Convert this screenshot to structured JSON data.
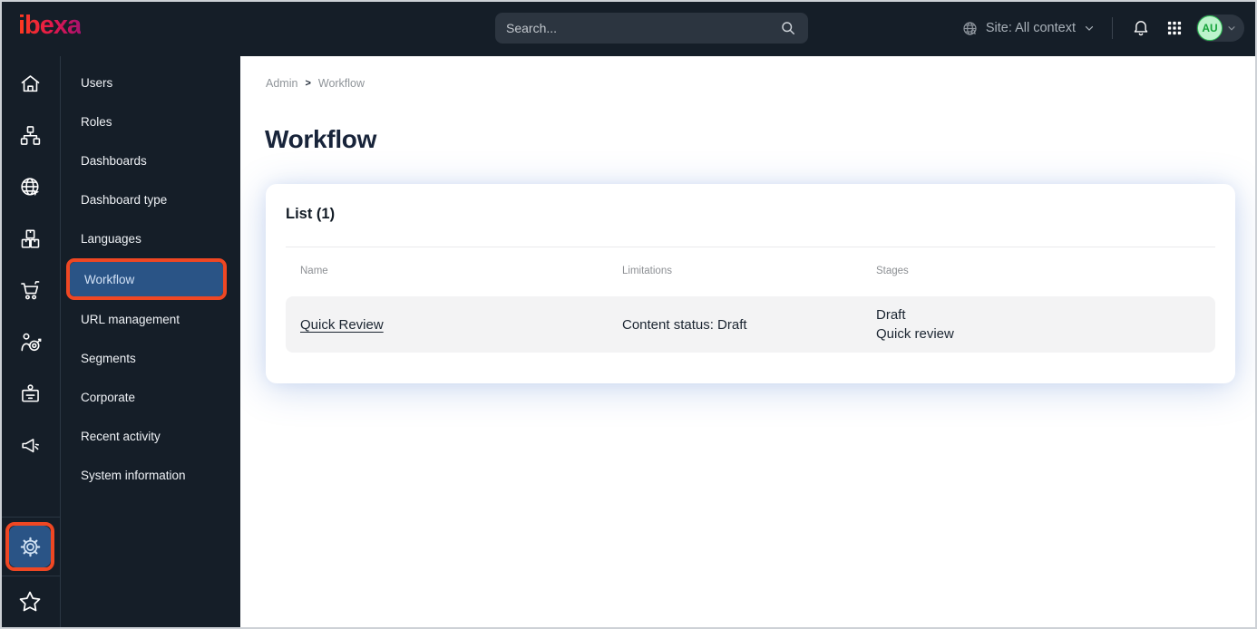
{
  "topbar": {
    "logo_text": "ibexa",
    "search": {
      "placeholder": "Search..."
    },
    "site_context_label": "Site: All context",
    "avatar_initials": "AU"
  },
  "rail": {
    "main_icons": [
      "home",
      "content-tree",
      "site-globe",
      "product-catalog",
      "commerce-cart",
      "personalization-target",
      "corporate-badge",
      "marketing-megaphone"
    ],
    "bottom_icons": [
      "settings-gear",
      "bookmarks-star"
    ],
    "active_icon": "settings-gear"
  },
  "sidebar": {
    "items": [
      "Users",
      "Roles",
      "Dashboards",
      "Dashboard type",
      "Languages",
      "Workflow",
      "URL management",
      "Segments",
      "Corporate",
      "Recent activity",
      "System information"
    ],
    "active_item": "Workflow"
  },
  "breadcrumb": {
    "items": [
      "Admin",
      "Workflow"
    ],
    "separator": ">"
  },
  "page": {
    "title": "Workflow"
  },
  "list_card": {
    "title": "List (1)",
    "columns": [
      "Name",
      "Limitations",
      "Stages"
    ],
    "rows": [
      {
        "name": "Quick Review",
        "limitations": "Content status: Draft",
        "stages": [
          "Draft",
          "Quick review"
        ]
      }
    ]
  },
  "colors": {
    "topbar_bg": "#151e28",
    "active_item_bg": "#2a5486",
    "annotation_highlight": "#ef4723",
    "avatar_bg": "#bdf2cc",
    "avatar_text": "#17a33b",
    "logo_gradient_start": "#ff3b1d",
    "logo_gradient_end": "#a8126e",
    "row_bg": "#f3f3f4"
  }
}
